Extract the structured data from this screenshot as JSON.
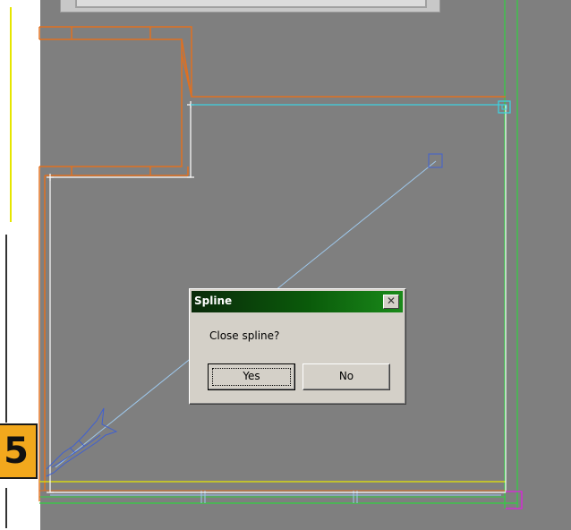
{
  "step_badge": "5",
  "dialog": {
    "title": "Spline",
    "close_glyph": "✕",
    "message": "Close spline?",
    "yes_label": "Yes",
    "no_label": "No"
  },
  "colors": {
    "viewport_bg": "#7f7f7f",
    "wall_orange": "#e07020",
    "selected_cyan": "#3fd0e0",
    "spline_blue": "#9ec8ec",
    "guide_white": "#ffffff",
    "border_green": "#30d040",
    "floor_yellow": "#e6e600",
    "corner_magenta": "#e020e0",
    "title_gradient_dark": "#0a2a0a",
    "title_gradient_light": "#1a8a1a"
  }
}
